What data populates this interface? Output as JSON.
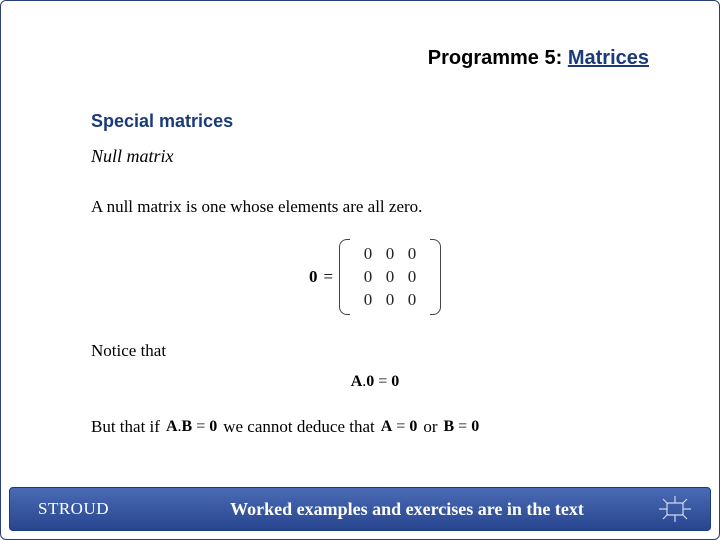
{
  "header": {
    "programme": "Programme 5:",
    "topic": "Matrices"
  },
  "section": {
    "title": "Special matrices",
    "subtitle": "Null matrix"
  },
  "para1": "A null matrix is one whose elements are all zero.",
  "matrix": {
    "lhs": "0",
    "eqsign": "=",
    "rows": [
      [
        "0",
        "0",
        "0"
      ],
      [
        "0",
        "0",
        "0"
      ],
      [
        "0",
        "0",
        "0"
      ]
    ]
  },
  "line2": {
    "notice": "Notice that",
    "eq": "A.0 = 0"
  },
  "line3": {
    "but": "But that if",
    "eq1": "A.B = 0",
    "mid": "we cannot deduce that",
    "eq2": "A = 0",
    "or": "or",
    "eq3": "B = 0"
  },
  "footer": {
    "brand": "STROUD",
    "text": "Worked examples and exercises are in the text",
    "icon": "nav-compass-icon"
  }
}
